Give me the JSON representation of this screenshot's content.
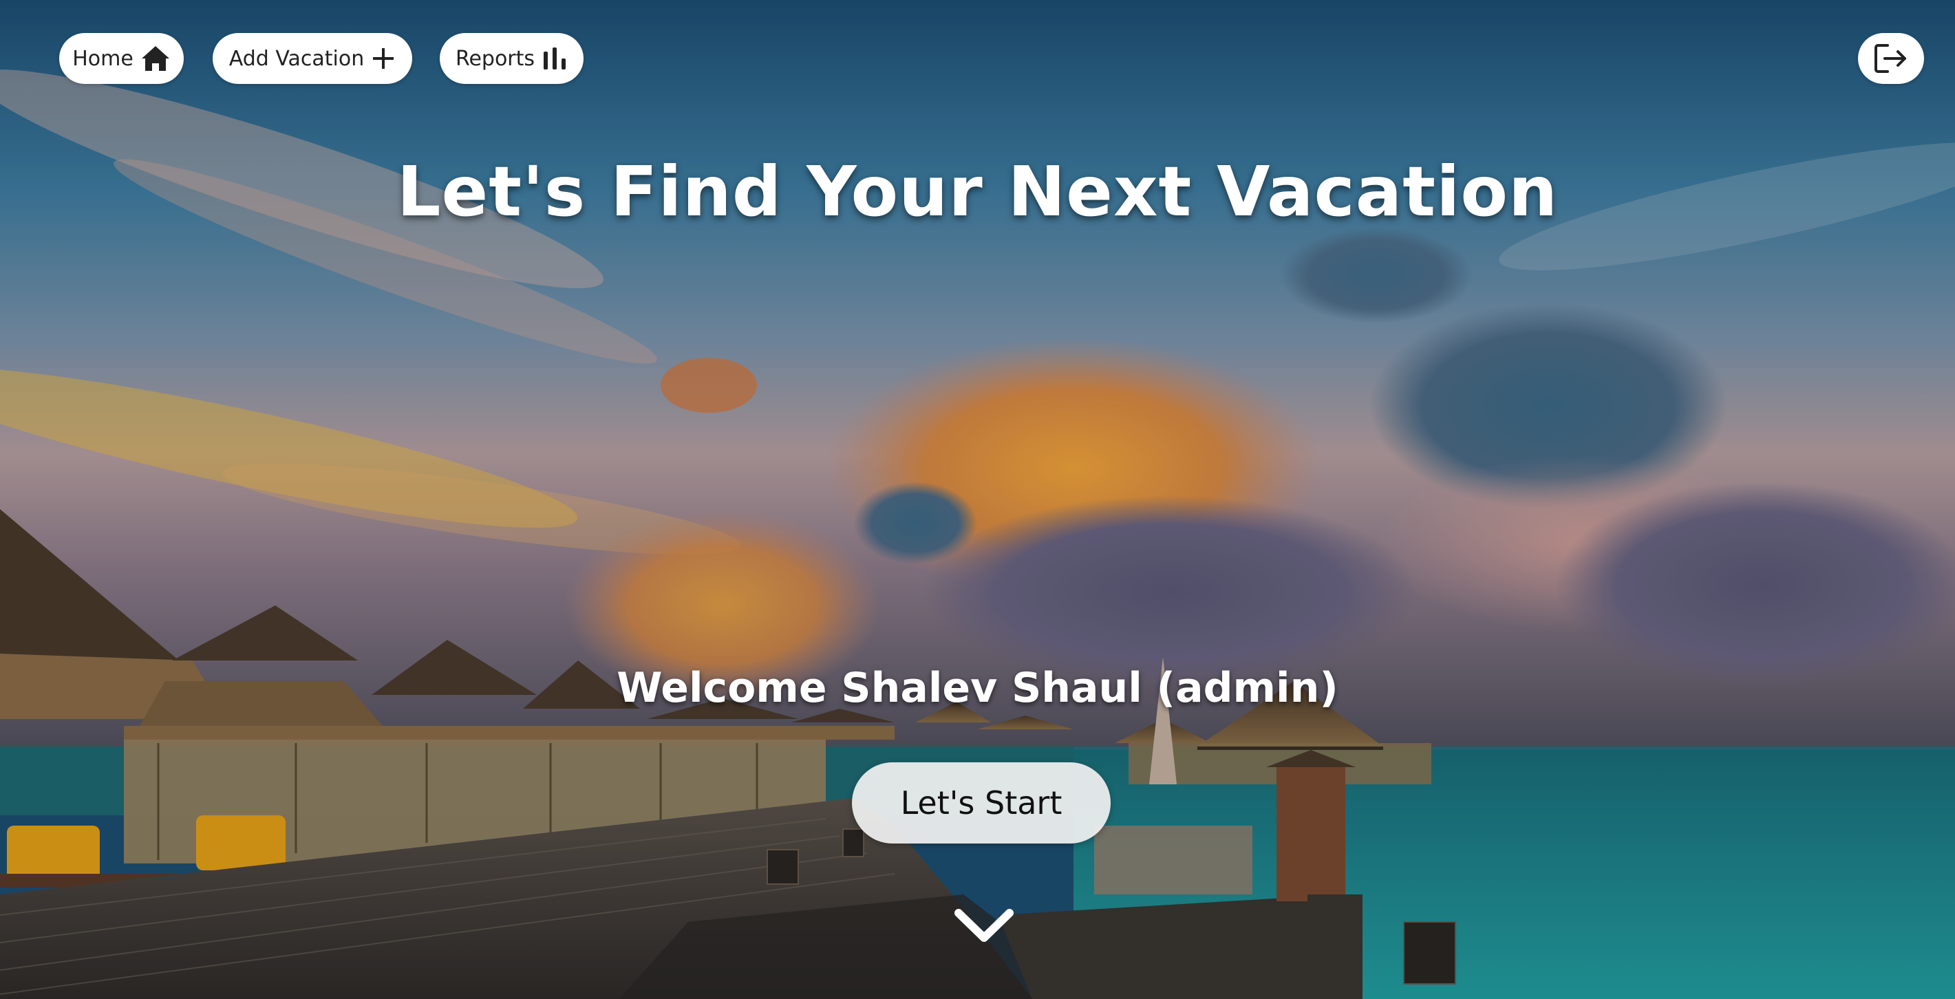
{
  "nav": {
    "home_label": "Home",
    "add_vacation_label": "Add Vacation",
    "reports_label": "Reports",
    "home_icon": "home-icon",
    "add_icon": "plus-icon",
    "reports_icon": "bar-chart-icon",
    "logout_icon": "logout-icon"
  },
  "hero": {
    "headline": "Let's Find Your Next Vacation",
    "welcome": "Welcome Shalev Shaul (admin)",
    "start_label": "Let's Start",
    "scroll_icon": "chevron-down-icon"
  },
  "colors": {
    "button_bg": "#ffffff",
    "button_text": "#222222",
    "heading_text": "#ffffff",
    "sky_top": "#1e5a80",
    "sea": "#1c8a8e"
  }
}
